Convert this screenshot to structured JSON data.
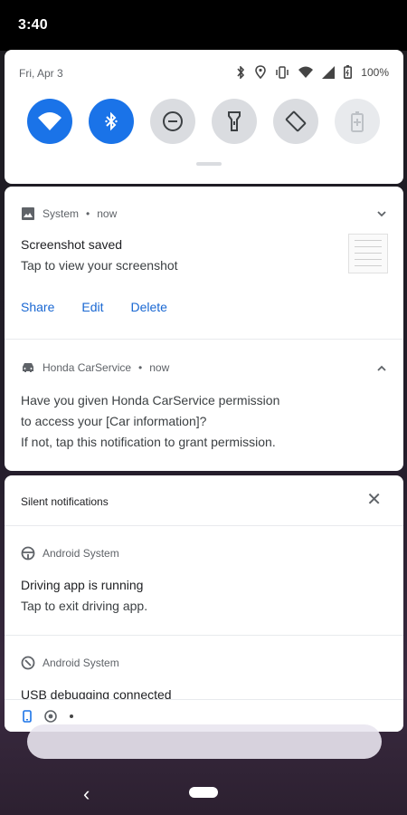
{
  "status_bar": {
    "time": "3:40"
  },
  "quick_settings": {
    "date": "Fri, Apr 3",
    "battery": "100%",
    "tiles": [
      "wifi",
      "bluetooth",
      "do-not-disturb",
      "flashlight",
      "auto-rotate",
      "battery-saver"
    ]
  },
  "notifications": {
    "screenshot": {
      "app": "System",
      "time": "now",
      "title": "Screenshot saved",
      "text": "Tap to view your screenshot",
      "actions": [
        "Share",
        "Edit",
        "Delete"
      ]
    },
    "carservice": {
      "app": "Honda CarService",
      "time": "now",
      "lines": [
        "Have you given Honda CarService permission",
        "to access your [Car information]?",
        "If not, tap this notification to grant permission."
      ]
    }
  },
  "silent": {
    "header": "Silent notifications",
    "items": [
      {
        "app": "Android System",
        "title": "Driving app is running",
        "text": "Tap to exit driving app."
      },
      {
        "app": "Android System",
        "title": "USB debugging connected"
      }
    ]
  },
  "colors": {
    "accent": "#1a73e8",
    "action": "#1967d2"
  }
}
